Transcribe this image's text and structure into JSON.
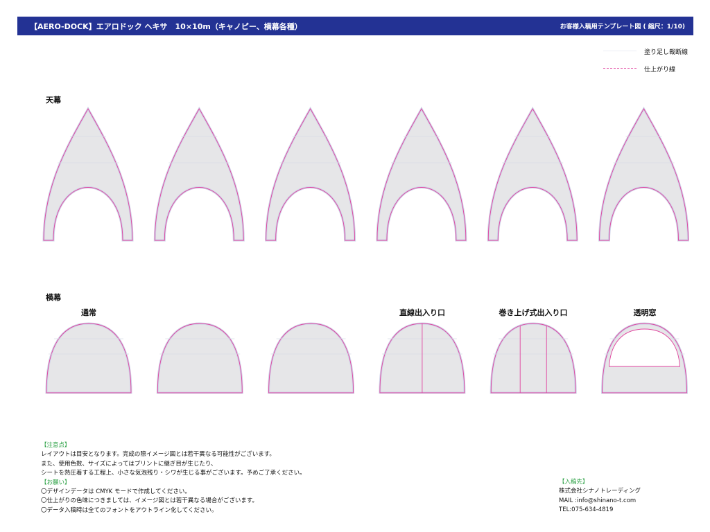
{
  "header": {
    "title": "【AERO-DOCK】エアロドック ヘキサ　10×10m（キャノピー、横幕各種）",
    "template_note": "お客様入稿用テンプレート図 ( 縮尺：1/10)"
  },
  "legend": {
    "bleed_label": "塗り足し裁断線",
    "trim_label": "仕上がり線"
  },
  "colors": {
    "header_bg": "#233294",
    "panel_fill": "#e6e6e8",
    "bleed_line": "#cfd3e8",
    "trim_line": "#e0429e",
    "note_heading": "#2aa043"
  },
  "sections": {
    "canopy_label": "天幕",
    "side_label": "横幕"
  },
  "side_panels": [
    {
      "label": "通常",
      "style": "plain"
    },
    {
      "label": "",
      "style": "plain"
    },
    {
      "label": "",
      "style": "plain"
    },
    {
      "label": "直線出入り口",
      "style": "center-door"
    },
    {
      "label": "巻き上げ式出入り口",
      "style": "rollup-door"
    },
    {
      "label": "透明窓",
      "style": "window"
    }
  ],
  "canopy_panel_count": 6,
  "notes": {
    "caution_heading": "【注意点】",
    "caution_lines": [
      "レイアウトは目安となります。完成の際イメージ図とは若干異なる可能性がございます。",
      "また、使用色数、サイズによってはプリントに継ぎ目が生じたり、",
      "シートを熱圧着する工程上、小さな気泡残り・シワが生じる事がございます。予めご了承ください。"
    ],
    "request_heading": "【お願い】",
    "request_lines": [
      "〇デザインデータは CMYK モードで作成してください。",
      "〇仕上がりの色味につきましては、イメージ図とは若干異なる場合がございます。",
      "〇データ入稿時は全てのフォントをアウトライン化してください。"
    ]
  },
  "contact": {
    "heading": "【入稿先】",
    "company": "株式会社シナノトレーディング",
    "mail": "MAIL :info@shinano-t.com",
    "tel": "TEL:075-634-4819"
  }
}
